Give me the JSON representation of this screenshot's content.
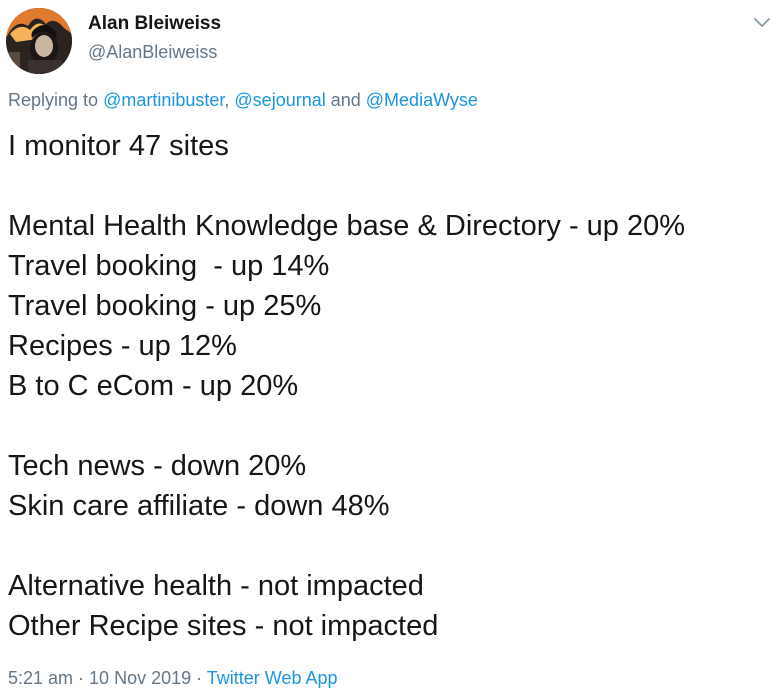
{
  "author": {
    "name": "Alan Bleiweiss",
    "handle": "@AlanBleiweiss",
    "avatar_icon": "profile-photo"
  },
  "reply": {
    "prefix": "Replying to ",
    "mention1": "@martinibuster",
    "sep1": ", ",
    "mention2": "@sejournal",
    "sep2": " and ",
    "mention3": "@MediaWyse"
  },
  "tweet_lines": [
    "I monitor 47 sites",
    "",
    "Mental Health Knowledge base & Directory - up 20%",
    "Travel booking  - up 14%",
    "Travel booking - up 25%",
    "Recipes - up 12%",
    "B to C eCom - up 20%",
    "",
    "Tech news - down 20%",
    "Skin care affiliate - down 48%",
    "",
    "Alternative health - not impacted",
    "Other Recipe sites - not impacted"
  ],
  "meta": {
    "time": "5:21 am",
    "sep1": " · ",
    "date": "10 Nov 2019",
    "sep2": " · ",
    "client": "Twitter Web App"
  },
  "colors": {
    "link": "#1b95e0",
    "secondary_text": "#657786",
    "primary_text": "#14171a"
  },
  "icons": {
    "menu": "chevron-down-icon"
  }
}
